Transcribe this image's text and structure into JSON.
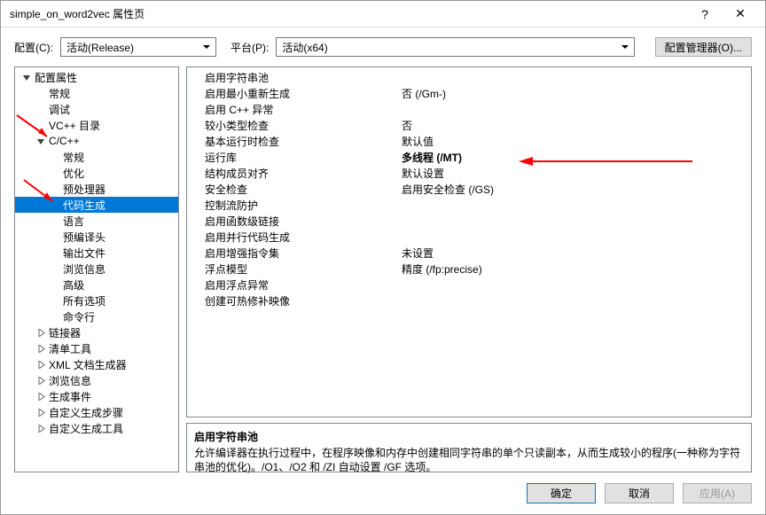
{
  "window": {
    "title": "simple_on_word2vec 属性页",
    "help_glyph": "?",
    "close_glyph": "✕"
  },
  "toolbar": {
    "config_label": "配置(C):",
    "config_value": "活动(Release)",
    "platform_label": "平台(P):",
    "platform_value": "活动(x64)",
    "config_manager_label": "配置管理器(O)..."
  },
  "tree": [
    {
      "label": "配置属性",
      "depth": 0,
      "exp": "open"
    },
    {
      "label": "常规",
      "depth": 1
    },
    {
      "label": "调试",
      "depth": 1
    },
    {
      "label": "VC++ 目录",
      "depth": 1
    },
    {
      "label": "C/C++",
      "depth": 1,
      "exp": "open"
    },
    {
      "label": "常规",
      "depth": 2
    },
    {
      "label": "优化",
      "depth": 2
    },
    {
      "label": "预处理器",
      "depth": 2
    },
    {
      "label": "代码生成",
      "depth": 2,
      "selected": true
    },
    {
      "label": "语言",
      "depth": 2
    },
    {
      "label": "预编译头",
      "depth": 2
    },
    {
      "label": "输出文件",
      "depth": 2
    },
    {
      "label": "浏览信息",
      "depth": 2
    },
    {
      "label": "高级",
      "depth": 2
    },
    {
      "label": "所有选项",
      "depth": 2
    },
    {
      "label": "命令行",
      "depth": 2
    },
    {
      "label": "链接器",
      "depth": 1,
      "exp": "closed"
    },
    {
      "label": "清单工具",
      "depth": 1,
      "exp": "closed"
    },
    {
      "label": "XML 文档生成器",
      "depth": 1,
      "exp": "closed"
    },
    {
      "label": "浏览信息",
      "depth": 1,
      "exp": "closed"
    },
    {
      "label": "生成事件",
      "depth": 1,
      "exp": "closed"
    },
    {
      "label": "自定义生成步骤",
      "depth": 1,
      "exp": "closed"
    },
    {
      "label": "自定义生成工具",
      "depth": 1,
      "exp": "closed"
    }
  ],
  "props": [
    {
      "name": "启用字符串池",
      "value": ""
    },
    {
      "name": "启用最小重新生成",
      "value": "否 (/Gm-)"
    },
    {
      "name": "启用 C++ 异常",
      "value": ""
    },
    {
      "name": "较小类型检查",
      "value": "否"
    },
    {
      "name": "基本运行时检查",
      "value": "默认值"
    },
    {
      "name": "运行库",
      "value": "多线程 (/MT)",
      "bold": true
    },
    {
      "name": "结构成员对齐",
      "value": "默认设置"
    },
    {
      "name": "安全检查",
      "value": "启用安全检查 (/GS)"
    },
    {
      "name": "控制流防护",
      "value": ""
    },
    {
      "name": "启用函数级链接",
      "value": ""
    },
    {
      "name": "启用并行代码生成",
      "value": ""
    },
    {
      "name": "启用增强指令集",
      "value": "未设置"
    },
    {
      "name": "浮点模型",
      "value": "精度 (/fp:precise)"
    },
    {
      "name": "启用浮点异常",
      "value": ""
    },
    {
      "name": "创建可热修补映像",
      "value": ""
    }
  ],
  "description": {
    "title": "启用字符串池",
    "body": "允许编译器在执行过程中，在程序映像和内存中创建相同字符串的单个只读副本，从而生成较小的程序(一种称为字符串池的优化)。/O1、/O2 和 /ZI 自动设置 /GF 选项。"
  },
  "footer": {
    "ok": "确定",
    "cancel": "取消",
    "apply": "应用(A)"
  },
  "annotations": {
    "color": "#ff0000"
  }
}
